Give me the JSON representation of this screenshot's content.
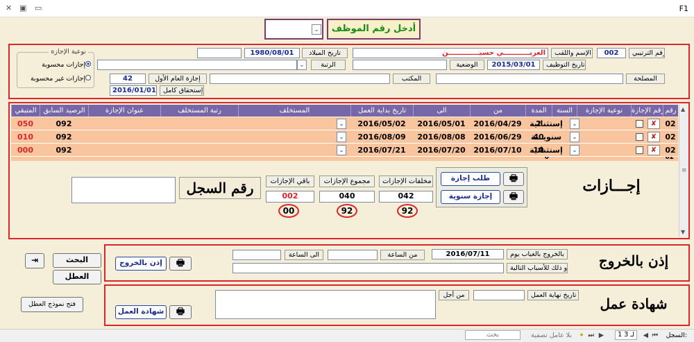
{
  "window": {
    "title": "F1",
    "status_record_label": "السجل:",
    "status_record_pos": "1 لـ 3",
    "status_filter": "بلا عامل تصفية",
    "status_search": "بحث"
  },
  "top": {
    "title": "أدخل رقم الموظف",
    "dropdown_value": ""
  },
  "emp": {
    "seq_label": "رقم الترتيبي",
    "seq_value": "002",
    "name_label": "الإسم واللقب",
    "name_value": "العربـــــــــــي حسيـــــــــــــن",
    "birth_label": "تاريخ الميلاد",
    "birth_value": "1980/08/01",
    "birth_extra": "",
    "hire_label": "تاريخ التوظيف",
    "hire_value": "2015/03/01",
    "status_label": "الوضعية",
    "status_value": "",
    "rank_label": "الرتبة",
    "rank_value": "",
    "dept_label": "المصلحة",
    "dept_value": "",
    "office_label": "المكتب",
    "office_value": "",
    "annual_label": "إجازة العام الأول",
    "annual_value": "42",
    "full_label": "إستحقاق كامل",
    "full_value": "2016/01/01",
    "leave_type_legend": "نوعية الإجازة",
    "opt_counted": "إجازات محسوبة",
    "opt_not_counted": "إجازات غير محسوبة"
  },
  "table": {
    "headers": [
      "رقم",
      "رقم الإجازة",
      "نوعية الإجازة",
      "السنة",
      "المدة",
      "من",
      "الى",
      "تاريخ بداية العمل",
      "المستخلف",
      "رتبة المستخلف",
      "عنوان الإجازة",
      "الرصيد السابق",
      "المتبقي"
    ],
    "rows": [
      {
        "num": "02",
        "type": "إستثنائية",
        "duration": "2",
        "from": "2016/04/29",
        "to": "2016/05/01",
        "start": "2016/05/02",
        "prev": "092",
        "remaining": "050"
      },
      {
        "num": "02",
        "type": "سنويـــة",
        "duration": "40",
        "from": "2016/06/29",
        "to": "2016/08/08",
        "start": "2016/08/09",
        "prev": "092",
        "remaining": "010"
      },
      {
        "num": "02",
        "type": "إستثنائية",
        "duration": "10",
        "from": "2016/07/10",
        "to": "2016/07/20",
        "start": "2016/07/21",
        "prev": "092",
        "remaining": "000"
      }
    ],
    "partial_duration": "0",
    "partial_num": "02"
  },
  "leaves": {
    "title": "إجـــازات",
    "request_btn": "طلب إجازة",
    "annual_btn": "إجازة سنوية",
    "arrears_label": "مخلفات الإجازات",
    "arrears_value": "042",
    "arrears_circle": "92",
    "total_label": "مجموع الإجازات",
    "total_value": "040",
    "total_circle": "92",
    "remain_label": "باقي الإجازات",
    "remain_value": "002",
    "remain_circle": "00",
    "record_label": "رقم السجل",
    "record_value": ""
  },
  "exit": {
    "title": "إذن بالخروج",
    "day_label": "بالخروج بالغياب يوم",
    "day_value": "2016/07/11",
    "from_label": "من الساعة",
    "from_value": "",
    "to_label": "الى الساعة",
    "to_value": "",
    "reason_label": "و ذلك للأسباب التالية",
    "reason_value": "",
    "btn": "إذن بالخروج"
  },
  "cert": {
    "title": "شهادة عمل",
    "end_label": "تاريخ نهاية العمل",
    "end_value": "",
    "for_label": "من أجل",
    "for_value": "",
    "btn": "شهادة العمل"
  },
  "side": {
    "search_btn": "البحث",
    "holiday_btn": "العطل",
    "model_btn": "فتح نموذج العطل"
  }
}
